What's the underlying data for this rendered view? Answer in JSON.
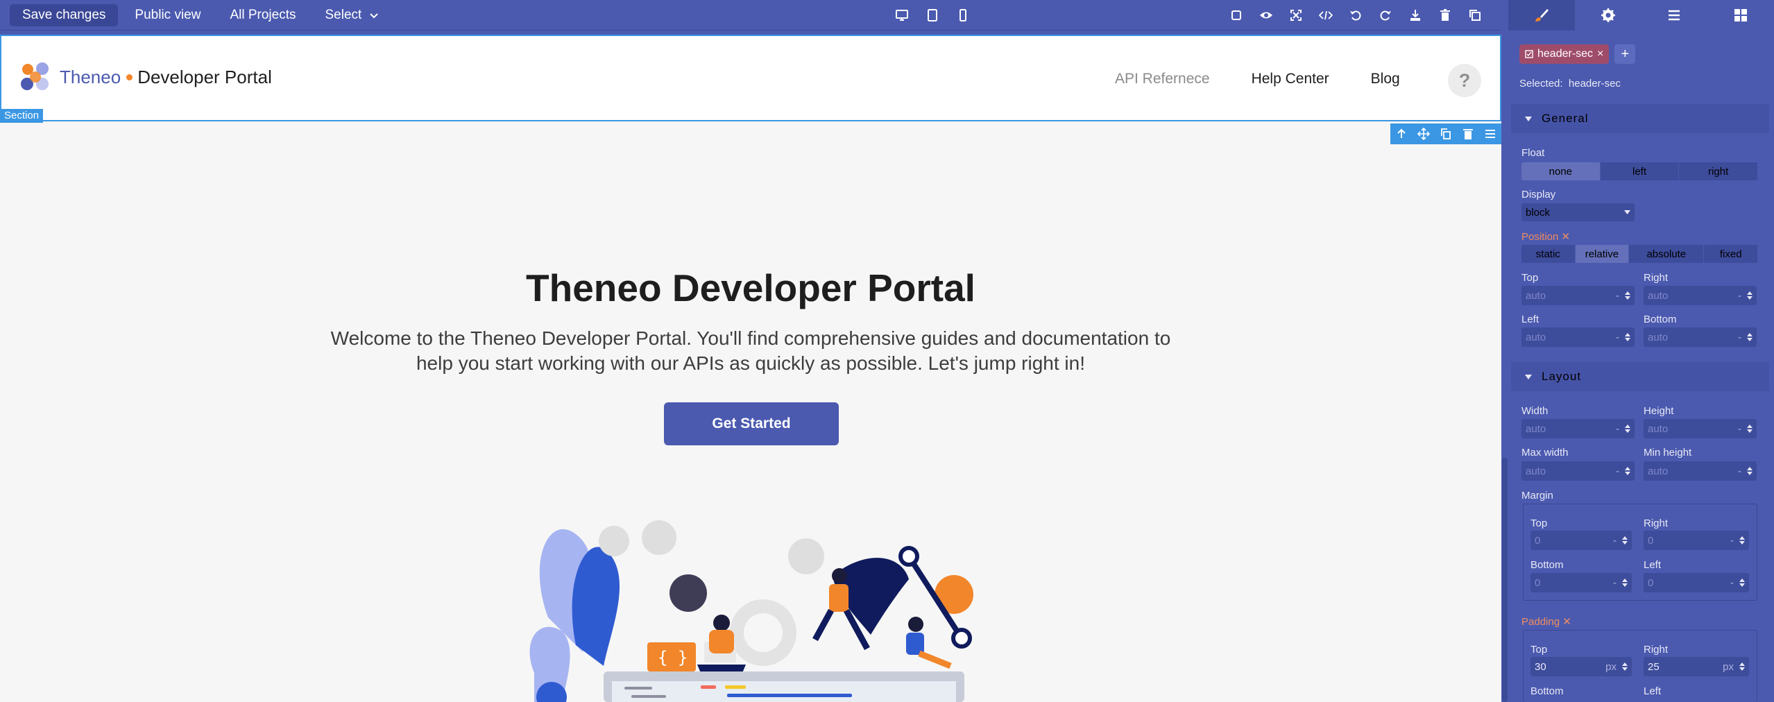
{
  "toolbar": {
    "save_label": "Save changes",
    "public_view_label": "Public view",
    "all_projects_label": "All Projects",
    "select_label": "Select"
  },
  "site": {
    "brand_prefix": "Theneo",
    "brand_suffix": "Developer Portal",
    "nav": [
      "API Refernece",
      "Help Center",
      "Blog"
    ],
    "help_icon": "?",
    "section_badge": "Section"
  },
  "hero": {
    "title": "Theneo Developer Portal",
    "subtitle_line1": "Welcome to the Theneo Developer Portal. You'll find comprehensive guides and documentation to",
    "subtitle_line2": "help you start working with our APIs as quickly as possible. Let's jump right in!",
    "cta": "Get Started"
  },
  "panel": {
    "tag": "header-sec",
    "selected_label": "Selected:",
    "selected_value": "header-sec",
    "general": {
      "title": "General",
      "float_label": "Float",
      "float_options": [
        "none",
        "left",
        "right"
      ],
      "float_selected": "none",
      "display_label": "Display",
      "display_value": "block",
      "position_label": "Position",
      "position_options": [
        "static",
        "relative",
        "absolute",
        "fixed"
      ],
      "position_selected": "relative",
      "top_label": "Top",
      "right_label": "Right",
      "left_label": "Left",
      "bottom_label": "Bottom",
      "auto": "auto",
      "dash": "-"
    },
    "layout": {
      "title": "Layout",
      "width_label": "Width",
      "height_label": "Height",
      "max_width_label": "Max width",
      "min_height_label": "Min height",
      "margin_label": "Margin",
      "margin": {
        "top": "0",
        "right": "0",
        "bottom": "0",
        "left": "0"
      },
      "padding_label": "Padding",
      "padding": {
        "top": "30",
        "right": "25",
        "unit": "px"
      },
      "top_label": "Top",
      "right_label": "Right",
      "bottom_label": "Bottom",
      "left_label": "Left"
    }
  },
  "colors": {
    "accent": "#4b5aaf",
    "selection": "#3b97e3",
    "orange": "#f2862a",
    "tag": "#9f4c6a"
  },
  "icons": [
    "monitor-icon",
    "tablet-icon",
    "mobile-icon",
    "square-icon",
    "eye-icon",
    "fullscreen-icon",
    "code-icon",
    "undo-icon",
    "redo-icon",
    "download-icon",
    "trash-icon",
    "copy-icon",
    "brush-icon",
    "gear-icon",
    "layers-icon",
    "blocks-icon"
  ]
}
